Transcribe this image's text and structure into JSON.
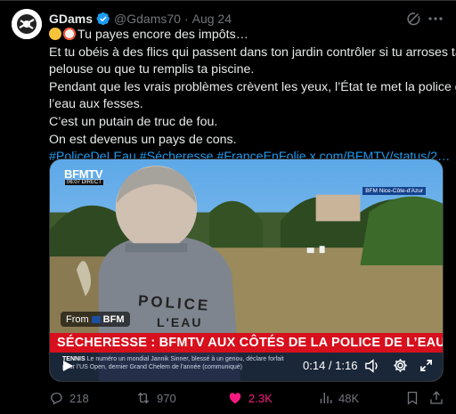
{
  "author": {
    "name": "GDams",
    "handle": "@Gdams70",
    "separator": "·",
    "date": "Aug 24"
  },
  "tweet": {
    "line1": "Tu payes encore des impôts…",
    "line2": "Et tu obéis à des flics qui passent dans ton jardin contrôler si tu arroses ta",
    "line3": "pelouse ou que tu remplis ta piscine.",
    "line4": "Pendant que les vrais problèmes crèvent les yeux, l’État te met la police de",
    "line5": "l’eau aux fesses.",
    "line6": "C’est un putain de truc de fou.",
    "line7": "On est devenus un pays de cons.",
    "hashtags": [
      "#PoliceDeLEau",
      "#Sécheresse",
      "#FranceEnFolie"
    ],
    "link": "x.com/BFMTV/status/2…"
  },
  "video": {
    "channel_logo": "BFMTV",
    "live_time": "06:07  DIRECT",
    "location": "BFM Nice-Côte-d'Azur",
    "vest_text": "POLICE",
    "vest_text2": "L'EAU",
    "from_label": "From",
    "from_source": "BFM",
    "headline": "SÉCHERESSE : BFMTV AUX CÔTÉS DE LA POLICE DE L’EAU",
    "ticker_tag": "TENNIS",
    "ticker_line1": "Le numéro un mondial Jannik Sinner, blessé à un genou, déclare forfait",
    "ticker_line2": "pour l’US Open, dernier Grand Chelem de l’année",
    "ticker_more": "(communiqué)",
    "time": "0:14 / 1:16"
  },
  "actions": {
    "replies": "218",
    "retweets": "970",
    "likes": "2.3K",
    "views": "48K"
  },
  "colors": {
    "background": "#000000",
    "text": "#e7e9ea",
    "muted": "#71767b",
    "link": "#1d9bf0",
    "like": "#f91880",
    "headline_bar": "#d80f1c"
  }
}
